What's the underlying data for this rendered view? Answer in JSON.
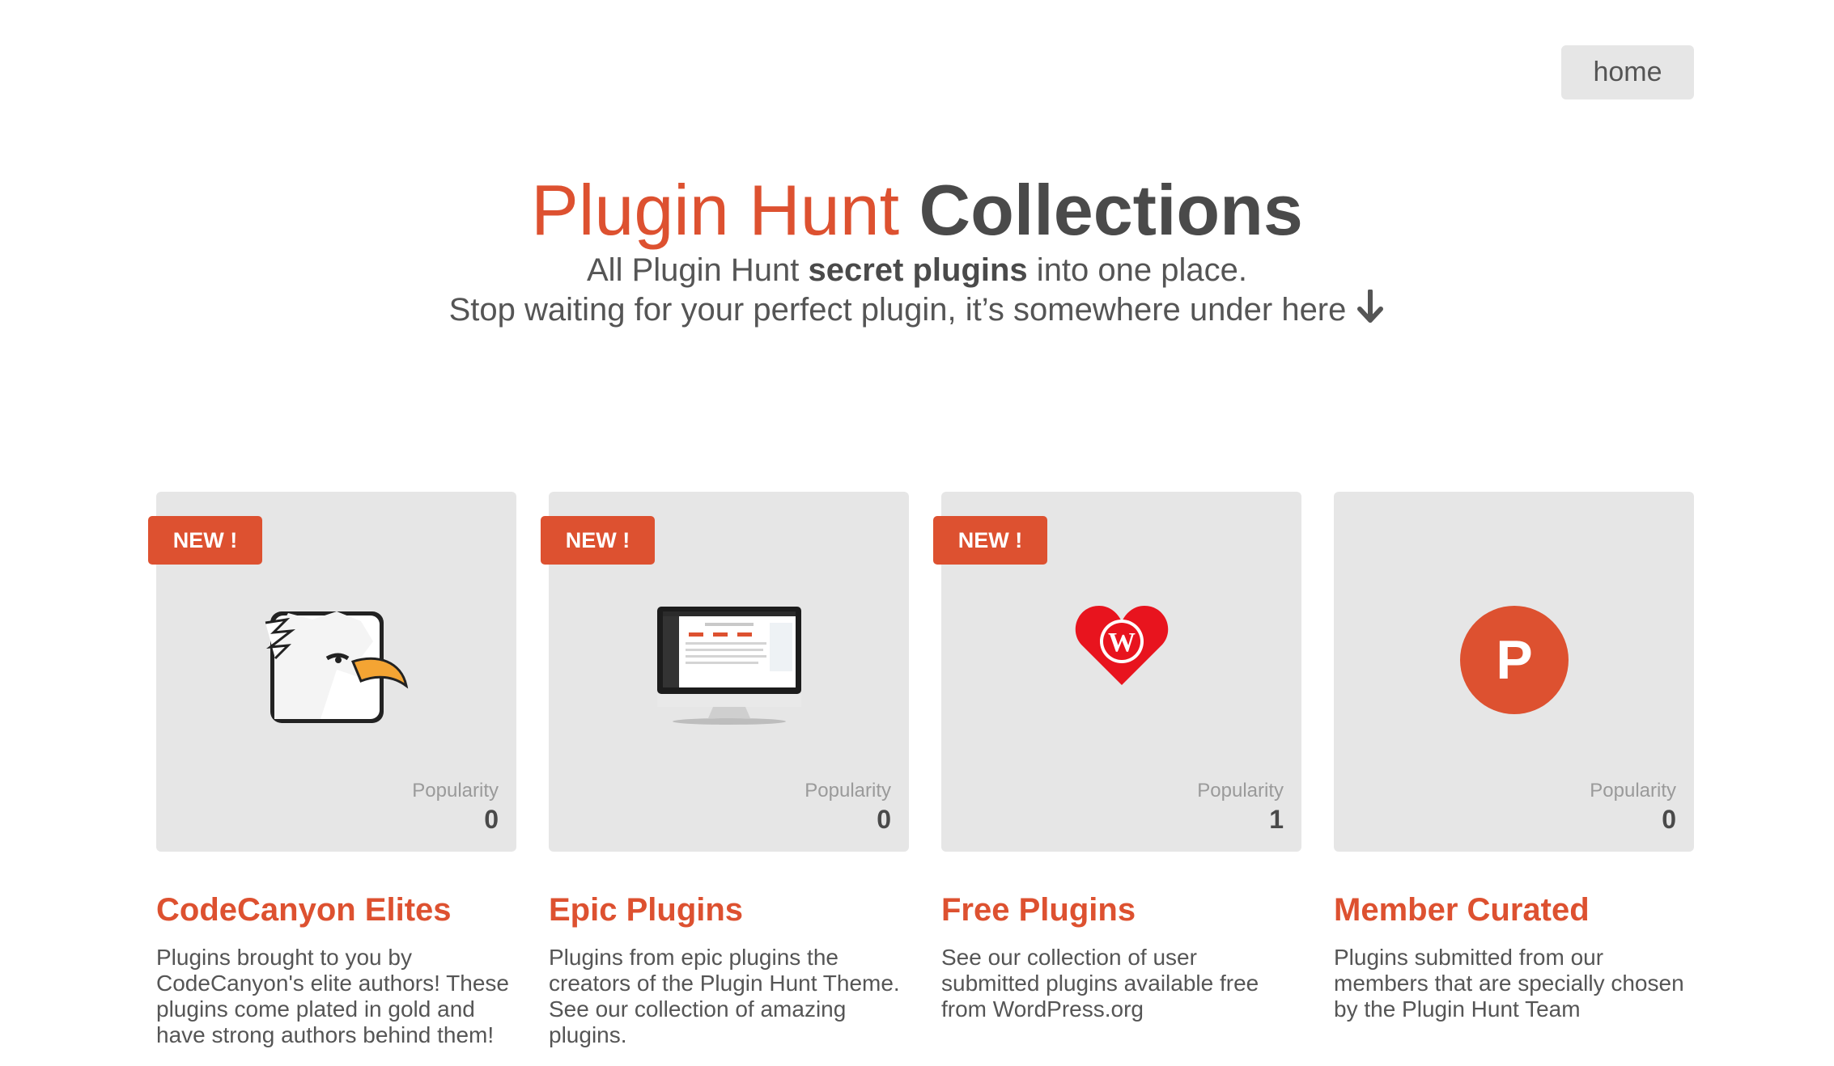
{
  "nav": {
    "home_label": "home"
  },
  "hero": {
    "title_accent": "Plugin Hunt",
    "title_strong": "Collections",
    "line1_pre": "All Plugin Hunt ",
    "line1_bold": "secret plugins",
    "line1_post": " into one place.",
    "line2": "Stop waiting for your perfect plugin, it’s somewhere under here",
    "arrow_icon": "arrow-down-icon"
  },
  "colors": {
    "accent": "#dd5130",
    "tile": "#e6e6e6",
    "text": "#555555"
  },
  "collections": [
    {
      "badge": "NEW !",
      "icon": "eagle-logo-icon",
      "popularity_label": "Popularity",
      "popularity": "0",
      "title": "CodeCanyon Elites",
      "description": "Plugins brought to you by CodeCanyon's elite authors! These plugins come plated in gold and have strong authors behind them!"
    },
    {
      "badge": "NEW !",
      "icon": "monitor-screenshot-icon",
      "popularity_label": "Popularity",
      "popularity": "0",
      "title": "Epic Plugins",
      "description": "Plugins from epic plugins the creators of the Plugin Hunt Theme. See our collection of amazing plugins."
    },
    {
      "badge": "NEW !",
      "icon": "wordpress-heart-icon",
      "popularity_label": "Popularity",
      "popularity": "1",
      "title": "Free Plugins",
      "description": "See our collection of user submitted plugins available free from WordPress.org"
    },
    {
      "badge": "",
      "icon": "p-circle-logo-icon",
      "popularity_label": "Popularity",
      "popularity": "0",
      "title": "Member Curated",
      "description": "Plugins submitted from our members that are specially chosen by the Plugin Hunt Team"
    }
  ]
}
